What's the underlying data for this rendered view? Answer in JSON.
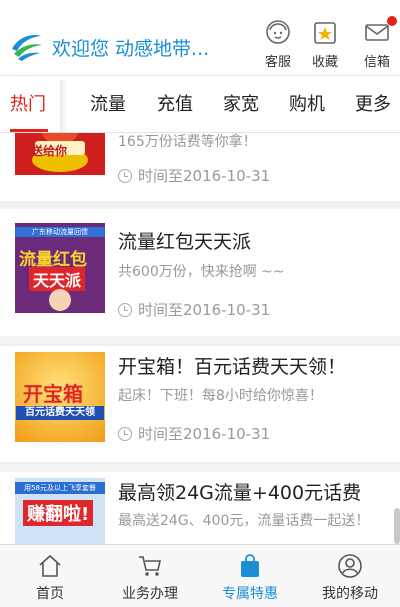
{
  "header": {
    "welcome": "欢迎您 动感地带...",
    "buttons": [
      {
        "label": "客服",
        "icon": "customer-service-icon"
      },
      {
        "label": "收藏",
        "icon": "favorites-icon"
      },
      {
        "label": "信箱",
        "icon": "mailbox-icon"
      }
    ],
    "brand_color": "#1a8fd7"
  },
  "tabs": {
    "items": [
      "热门",
      "流量",
      "充值",
      "家宽",
      "购机",
      "更多"
    ],
    "active": "热门",
    "active_color": "#e2231a"
  },
  "feed": {
    "cards": [
      {
        "title": "",
        "subtitle": "165万份话费等你拿！",
        "thumb_text": "送给你",
        "time": "时间至2016-10-31"
      },
      {
        "title": "流量红包天天派",
        "subtitle": "共600万份，快来抢啊 ~~",
        "thumb_banner": "广东移动流量回馈",
        "thumb_line1": "流量红包",
        "thumb_line2": "天天派",
        "time": "时间至2016-10-31"
      },
      {
        "title": "开宝箱！百元话费天天领！",
        "subtitle": "起床！下班！每8小时给你惊喜！",
        "thumb_line1": "开宝箱",
        "thumb_line2": "百元话费天天领",
        "time": "时间至2016-10-31"
      },
      {
        "title": "最高领24G流量+400元话费",
        "subtitle": "最高送24G、400元，流量话费一起送！",
        "thumb_line1": "用58元及以上飞享套餐",
        "thumb_line2": "赚翻啦!",
        "time": ""
      }
    ]
  },
  "bottom_nav": {
    "items": [
      {
        "label": "首页",
        "icon": "home-icon"
      },
      {
        "label": "业务办理",
        "icon": "cart-icon"
      },
      {
        "label": "专属特惠",
        "icon": "shopping-bag-icon"
      },
      {
        "label": "我的移动",
        "icon": "user-icon"
      }
    ],
    "active": "专属特惠"
  }
}
